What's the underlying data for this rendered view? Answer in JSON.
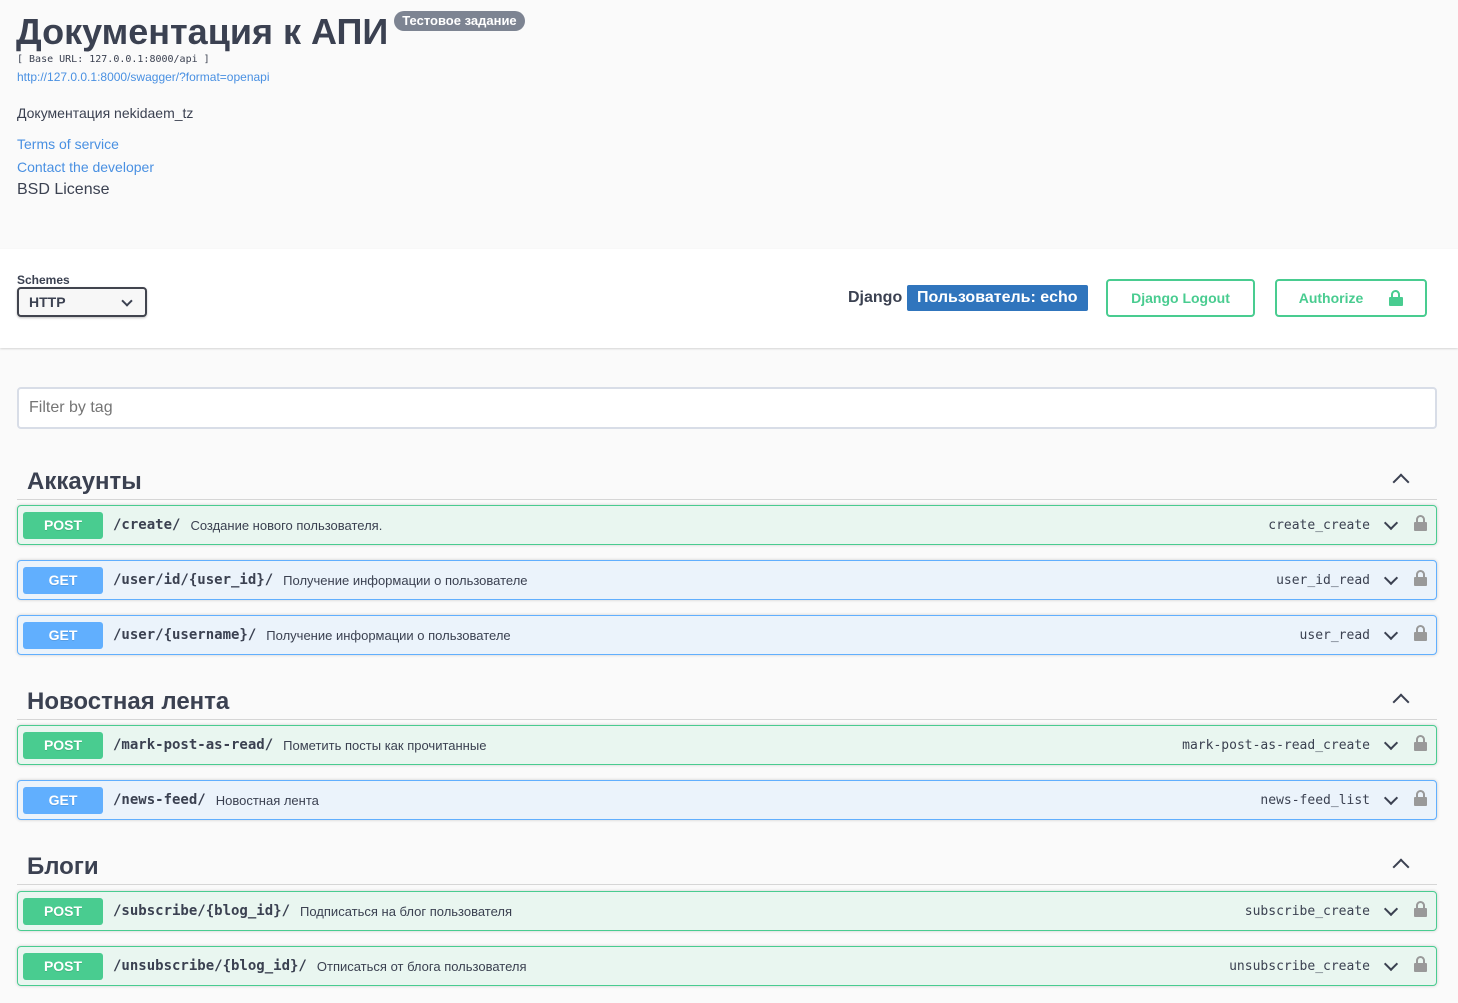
{
  "info": {
    "title": "Документация к АПИ",
    "version_badge": "Тестовое задание",
    "base_url": "[ Base URL: 127.0.0.1:8000/api ]",
    "spec_link": "http://127.0.0.1:8000/swagger/?format=openapi",
    "description": "Документация nekidaem_tz",
    "terms_of_service": "Terms of service",
    "contact": "Contact the developer",
    "license": "BSD License"
  },
  "schemes": {
    "label": "Schemes",
    "selected": "HTTP"
  },
  "auth": {
    "django_label": "Django",
    "user_badge": "Пользователь: echo",
    "logout_label": "Django Logout",
    "authorize_label": "Authorize"
  },
  "filter": {
    "placeholder": "Filter by tag"
  },
  "tags": [
    {
      "name": "Аккаунты",
      "operations": [
        {
          "method": "POST",
          "path": "/create/",
          "summary": "Создание нового пользователя.",
          "operation_id": "create_create"
        },
        {
          "method": "GET",
          "path": "/user/id/{user_id}/",
          "summary": "Получение информации о пользователе",
          "operation_id": "user_id_read"
        },
        {
          "method": "GET",
          "path": "/user/{username}/",
          "summary": "Получение информации о пользователе",
          "operation_id": "user_read"
        }
      ]
    },
    {
      "name": "Новостная лента",
      "operations": [
        {
          "method": "POST",
          "path": "/mark-post-as-read/",
          "summary": "Пометить посты как прочитанные",
          "operation_id": "mark-post-as-read_create"
        },
        {
          "method": "GET",
          "path": "/news-feed/",
          "summary": "Новостная лента",
          "operation_id": "news-feed_list"
        }
      ]
    },
    {
      "name": "Блоги",
      "operations": [
        {
          "method": "POST",
          "path": "/subscribe/{blog_id}/",
          "summary": "Подписаться на блог пользователя",
          "operation_id": "subscribe_create"
        },
        {
          "method": "POST",
          "path": "/unsubscribe/{blog_id}/",
          "summary": "Отписаться от блога пользователя",
          "operation_id": "unsubscribe_create"
        }
      ]
    }
  ],
  "colors": {
    "post": "#49cc90",
    "get": "#61affe",
    "link": "#4990e2",
    "user_badge": "#3075bd"
  }
}
